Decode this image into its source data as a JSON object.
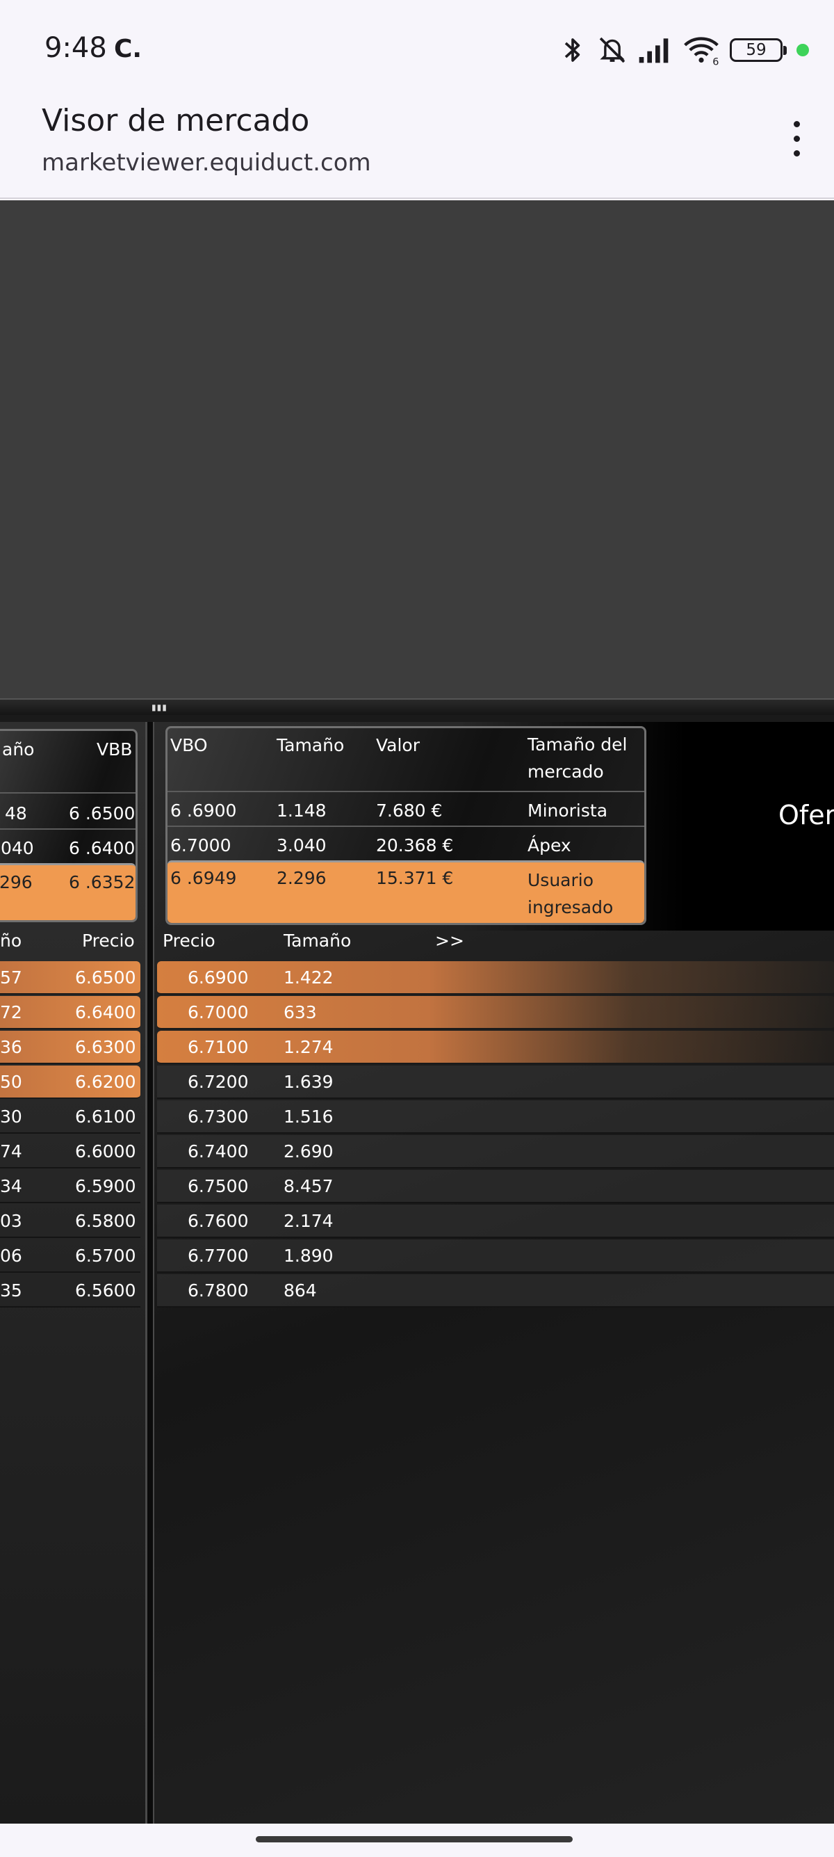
{
  "status_bar": {
    "time": "9:48",
    "carrier_glyph": "C.",
    "battery": "59",
    "icons": [
      "bluetooth-icon",
      "mute-icon",
      "signal-icon",
      "wifi-icon",
      "battery-icon"
    ],
    "wifi_badge": "6",
    "dot_color": "#3ed35a"
  },
  "browser": {
    "title": "Visor de mercado",
    "url": "marketviewer.equiduct.com"
  },
  "left_summary": {
    "headers": [
      "año",
      "VBB"
    ],
    "rows": [
      {
        "size": "48",
        "price": "6 .6500"
      },
      {
        "size": "040",
        "price": "6 .6400"
      },
      {
        "size": "296",
        "price": "6 .6352",
        "highlight": true
      }
    ]
  },
  "right_summary": {
    "headers": [
      "VBO",
      "Tamaño",
      "Valor",
      "Tamaño del mercado"
    ],
    "header_last_lines": [
      "Tamaño del",
      "mercado"
    ],
    "rows": [
      {
        "vbo": "6 .6900",
        "size": "1.148",
        "value": "7.680 €",
        "market": "Minorista"
      },
      {
        "vbo": "6.7000",
        "size": "3.040",
        "value": "20.368 €",
        "market": "Ápex"
      },
      {
        "vbo": "6 .6949",
        "size": "2.296",
        "value": "15.371 €",
        "market_lines": [
          "Usuario",
          "ingresado"
        ],
        "highlight": true
      }
    ],
    "side_label": "Ofer"
  },
  "left_depth": {
    "headers": [
      "ño",
      "Precio"
    ],
    "rows": [
      {
        "size": "57",
        "price": "6.6500",
        "highlight": true
      },
      {
        "size": "72",
        "price": "6.6400",
        "highlight": true
      },
      {
        "size": "36",
        "price": "6.6300",
        "highlight": true
      },
      {
        "size": "50",
        "price": "6.6200",
        "highlight": true
      },
      {
        "size": "30",
        "price": "6.6100"
      },
      {
        "size": "74",
        "price": "6.6000"
      },
      {
        "size": "34",
        "price": "6.5900"
      },
      {
        "size": "03",
        "price": "6.5800"
      },
      {
        "size": "06",
        "price": "6.5700"
      },
      {
        "size": "35",
        "price": "6.5600"
      }
    ]
  },
  "right_depth": {
    "headers": [
      "Precio",
      "Tamaño",
      ">>"
    ],
    "rows": [
      {
        "price": "6.6900",
        "size": "1.422",
        "highlight": true
      },
      {
        "price": "6.7000",
        "size": "633",
        "highlight": true
      },
      {
        "price": "6.7100",
        "size": "1.274",
        "highlight": true
      },
      {
        "price": "6.7200",
        "size": "1.639"
      },
      {
        "price": "6.7300",
        "size": "1.516"
      },
      {
        "price": "6.7400",
        "size": "2.690"
      },
      {
        "price": "6.7500",
        "size": "8.457"
      },
      {
        "price": "6.7600",
        "size": "2.174"
      },
      {
        "price": "6.7700",
        "size": "1.890"
      },
      {
        "price": "6.7800",
        "size": "864"
      }
    ]
  },
  "colors": {
    "highlight_orange": "#f09a50",
    "row_orange": "#d57f40",
    "panel_dark": "#1a1a1a"
  }
}
